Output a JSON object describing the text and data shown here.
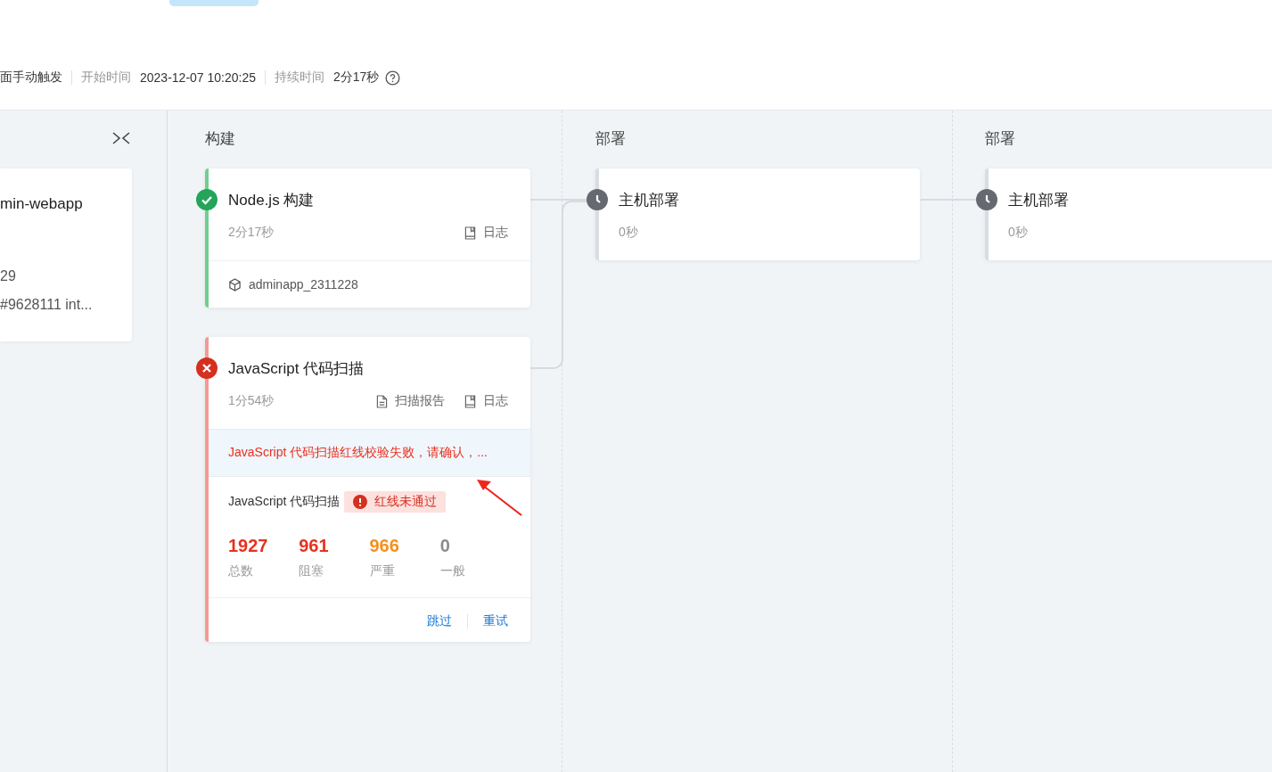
{
  "header": {
    "meta": [
      {
        "value": "面手动触发"
      },
      {
        "label": "开始时间",
        "value": "2023-12-07 10:20:25"
      },
      {
        "label": "持续时间",
        "value": "2分17秒",
        "help": true
      }
    ]
  },
  "source_card": {
    "title": "min-webapp",
    "lines": [
      "29",
      "#9628111 int..."
    ]
  },
  "stages": [
    {
      "title": "构建",
      "jobs": [
        {
          "name": "Node.js 构建",
          "kind": "success",
          "duration": "2分17秒",
          "actions": [
            {
              "kind": "log",
              "label": "日志"
            }
          ],
          "artifact": "adminapp_2311228"
        },
        {
          "name": "JavaScript 代码扫描",
          "kind": "failed",
          "duration": "1分54秒",
          "actions": [
            {
              "kind": "report",
              "label": "扫描报告"
            },
            {
              "kind": "log",
              "label": "日志"
            }
          ],
          "error": "JavaScript 代码扫描红线校验失败，请确认，...",
          "scan": {
            "name": "JavaScript 代码扫描",
            "badge": "红线未通过",
            "stats": [
              {
                "value": "1927",
                "label": "总数",
                "color": "#e8311f"
              },
              {
                "value": "961",
                "label": "阻塞",
                "color": "#e8311f"
              },
              {
                "value": "966",
                "label": "严重",
                "color": "#f5901e"
              },
              {
                "value": "0",
                "label": "一般",
                "color": "#8c8c8c"
              }
            ]
          },
          "buttons": [
            "跳过",
            "重试"
          ]
        }
      ]
    },
    {
      "title": "部署",
      "jobs": [
        {
          "name": "主机部署",
          "kind": "pending",
          "duration": "0秒"
        }
      ]
    },
    {
      "title": "部署",
      "jobs": [
        {
          "name": "主机部署",
          "kind": "pending",
          "duration": "0秒"
        }
      ]
    }
  ]
}
